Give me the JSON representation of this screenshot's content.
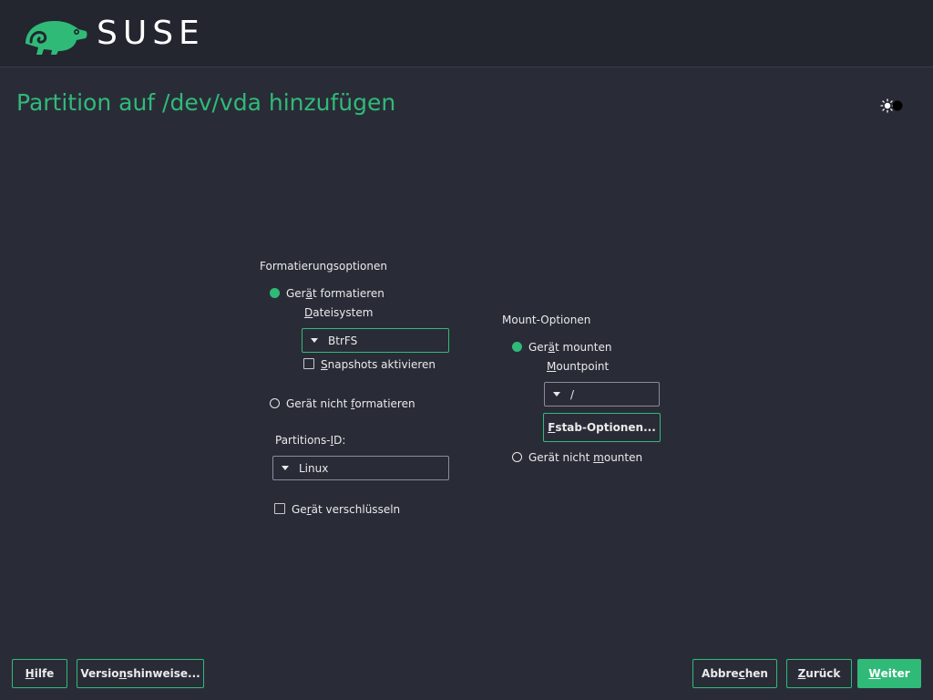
{
  "header": {
    "brand": "SUSE"
  },
  "page": {
    "title": "Partition auf /dev/vda hinzufügen"
  },
  "format": {
    "section_label": "Formatierungsoptionen",
    "format_device": {
      "pre": "Ger",
      "key": "ä",
      "post": "t formatieren",
      "selected": true
    },
    "filesystem_label": {
      "pre": "",
      "key": "D",
      "post": "ateisystem"
    },
    "filesystem_value": "BtrFS",
    "snapshots": {
      "pre": "",
      "key": "S",
      "post": "napshots aktivieren",
      "checked": false
    },
    "no_format": {
      "pre": "Gerät nicht ",
      "key": "f",
      "post": "ormatieren",
      "selected": false
    },
    "partition_id_label": {
      "pre": "Partitions-",
      "key": "I",
      "post": "D:"
    },
    "partition_id_value": "Linux",
    "encrypt": {
      "pre": "Ge",
      "key": "r",
      "post": "ät verschlüsseln",
      "checked": false
    }
  },
  "mount": {
    "section_label": "Mount-Optionen",
    "mount_device": {
      "pre": "Ger",
      "key": "ä",
      "post": "t mounten",
      "selected": true
    },
    "mountpoint_label": {
      "pre": "",
      "key": "M",
      "post": "ountpoint"
    },
    "mountpoint_value": "/",
    "fstab_button": {
      "pre": "",
      "key": "F",
      "post": "stab-Optionen..."
    },
    "no_mount": {
      "pre": "Gerät nicht ",
      "key": "m",
      "post": "ounten",
      "selected": false
    }
  },
  "footer": {
    "help": {
      "pre": "",
      "key": "H",
      "post": "ilfe"
    },
    "release_notes": {
      "pre": "Versio",
      "key": "n",
      "post": "shinweise..."
    },
    "cancel": {
      "pre": "Abbre",
      "key": "c",
      "post": "hen"
    },
    "back": {
      "pre": "",
      "key": "Z",
      "post": "urück"
    },
    "next": {
      "pre": "",
      "key": "W",
      "post": "eiter"
    }
  },
  "colors": {
    "accent": "#30ba78",
    "background": "#292c37",
    "header": "#23262f"
  },
  "icons": {
    "logo": "chameleon-icon",
    "theme": "theme-toggle-icon"
  }
}
